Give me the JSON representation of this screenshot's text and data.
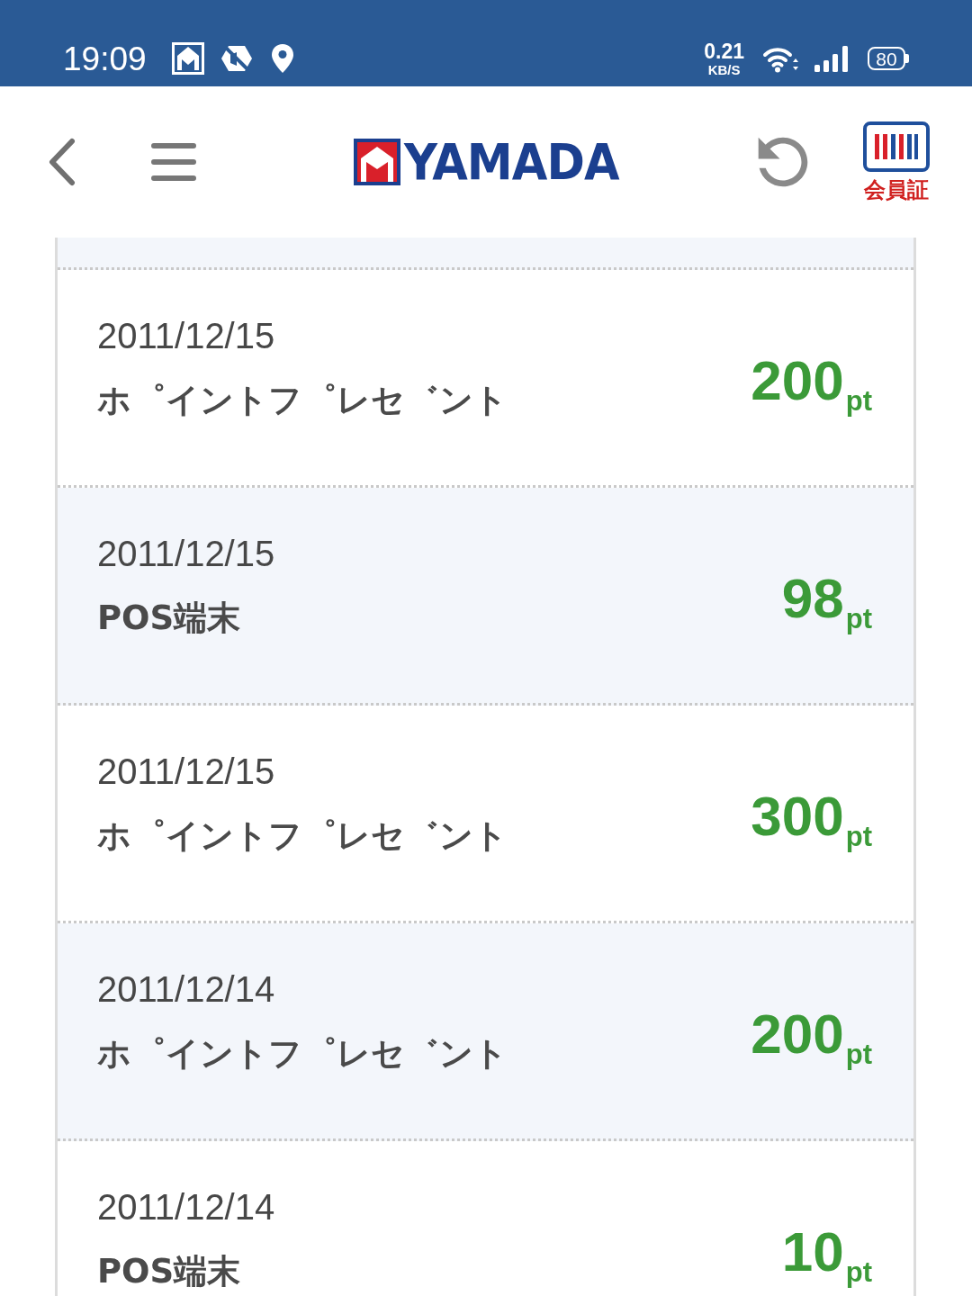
{
  "status_bar": {
    "time": "19:09",
    "network_speed": "0.21",
    "network_speed_unit": "KB/S",
    "battery": "80"
  },
  "header": {
    "logo_text": "YAMADA",
    "member_card_label": "会員証"
  },
  "history": [
    {
      "date": "2011/12/15",
      "description": "ホ゜イントフ゜レセ゛ント",
      "amount": "200",
      "unit": "pt"
    },
    {
      "date": "2011/12/15",
      "description": "POS端末",
      "amount": "98",
      "unit": "pt"
    },
    {
      "date": "2011/12/15",
      "description": "ホ゜イントフ゜レセ゛ント",
      "amount": "300",
      "unit": "pt"
    },
    {
      "date": "2011/12/14",
      "description": "ホ゜イントフ゜レセ゛ント",
      "amount": "200",
      "unit": "pt"
    },
    {
      "date": "2011/12/14",
      "description": "POS端末",
      "amount": "10",
      "unit": "pt"
    }
  ]
}
